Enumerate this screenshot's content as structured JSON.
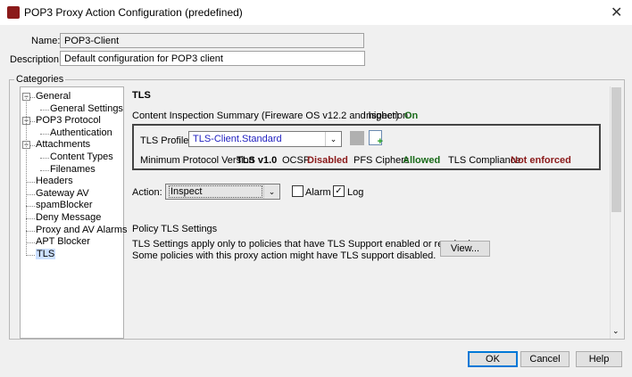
{
  "window": {
    "title": "POP3 Proxy Action Configuration (predefined)",
    "close": "✕"
  },
  "name": {
    "label": "Name:",
    "value": "POP3-Client"
  },
  "description": {
    "label": "Description:",
    "value": "Default configuration for POP3 client"
  },
  "categories": {
    "label": "Categories",
    "tree": [
      {
        "label": "General",
        "level": 0,
        "expander": "−"
      },
      {
        "label": "General Settings",
        "level": 1
      },
      {
        "label": "POP3 Protocol",
        "level": 0,
        "expander": "−"
      },
      {
        "label": "Authentication",
        "level": 1
      },
      {
        "label": "Attachments",
        "level": 0,
        "expander": "−"
      },
      {
        "label": "Content Types",
        "level": 1
      },
      {
        "label": "Filenames",
        "level": 1
      },
      {
        "label": "Headers",
        "level": 0
      },
      {
        "label": "Gateway AV",
        "level": 0
      },
      {
        "label": "spamBlocker",
        "level": 0
      },
      {
        "label": "Deny Message",
        "level": 0
      },
      {
        "label": "Proxy and AV Alarms",
        "level": 0
      },
      {
        "label": "APT Blocker",
        "level": 0
      },
      {
        "label": "TLS",
        "level": 0,
        "selected": true
      }
    ]
  },
  "tls": {
    "heading": "TLS",
    "summary_label": "Content Inspection Summary (Fireware OS v12.2 and higher)",
    "inspection_label": "Inspection",
    "inspection_value": "On",
    "profile_label": "TLS Profile:",
    "profile_value": "TLS-Client.Standard",
    "min_proto_label": "Minimum Protocol Version",
    "min_proto_value": "TLS v1.0",
    "ocsp_label": "OCSP",
    "ocsp_value": "Disabled",
    "pfs_label": "PFS Ciphers",
    "pfs_value": "Allowed",
    "compliance_label": "TLS Compliance",
    "compliance_value": "Not enforced",
    "action_label": "Action:",
    "action_value": "Inspect",
    "alarm_label": "Alarm",
    "alarm_checked": false,
    "log_label": "Log",
    "log_checked": true,
    "policy_heading": "Policy TLS Settings",
    "policy_line1": "TLS Settings apply only to policies that have TLS Support enabled or required.",
    "policy_line2": "Some policies with this proxy action might have TLS support disabled.",
    "view_label": "View..."
  },
  "buttons": {
    "ok": "OK",
    "cancel": "Cancel",
    "help": "Help"
  },
  "colors": {
    "disabled": "#8b1a1a",
    "allowed": "#1a6b1a",
    "selection": "#cce0ff",
    "ok_border": "#0078d7"
  }
}
